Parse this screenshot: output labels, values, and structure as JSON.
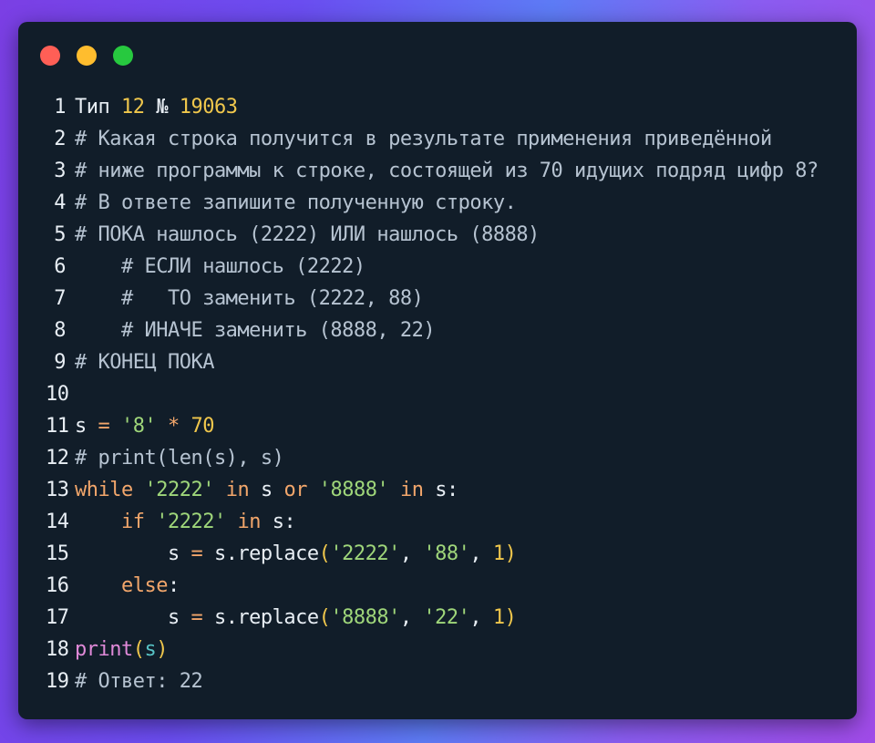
{
  "window": {
    "traffic_lights": [
      "close-dot",
      "minimize-dot",
      "maximize-dot"
    ],
    "colors": {
      "close": "#ff5f56",
      "minimize": "#ffbd2e",
      "maximize": "#27c93f",
      "background": "#111d29"
    }
  },
  "code": {
    "lines": [
      {
        "n": "1",
        "tokens": [
          {
            "t": "Тип ",
            "c": "plain"
          },
          {
            "t": "12",
            "c": "num"
          },
          {
            "t": " № ",
            "c": "plain"
          },
          {
            "t": "19063",
            "c": "num"
          }
        ]
      },
      {
        "n": "2",
        "tokens": [
          {
            "t": "# Какая строка получится в результате применения приведённой",
            "c": "cm"
          }
        ]
      },
      {
        "n": "3",
        "tokens": [
          {
            "t": "# ниже программы к строке, состоящей из 70 идущих подряд цифр 8?",
            "c": "cm"
          }
        ]
      },
      {
        "n": "4",
        "tokens": [
          {
            "t": "# В ответе запишите полученную строку.",
            "c": "cm"
          }
        ]
      },
      {
        "n": "5",
        "tokens": [
          {
            "t": "# ПОКА нашлось (2222) ИЛИ нашлось (8888)",
            "c": "cm"
          }
        ]
      },
      {
        "n": "6",
        "tokens": [
          {
            "t": "    # ЕСЛИ нашлось (2222)",
            "c": "cm"
          }
        ]
      },
      {
        "n": "7",
        "tokens": [
          {
            "t": "    #   ТО заменить (2222, 88)",
            "c": "cm"
          }
        ]
      },
      {
        "n": "8",
        "tokens": [
          {
            "t": "    # ИНАЧЕ заменить (8888, 22)",
            "c": "cm"
          }
        ]
      },
      {
        "n": "9",
        "tokens": [
          {
            "t": "# КОНЕЦ ПОКА",
            "c": "cm"
          }
        ]
      },
      {
        "n": "10",
        "tokens": []
      },
      {
        "n": "11",
        "tokens": [
          {
            "t": "s ",
            "c": "var"
          },
          {
            "t": "=",
            "c": "op"
          },
          {
            "t": " ",
            "c": "plain"
          },
          {
            "t": "'8'",
            "c": "str"
          },
          {
            "t": " ",
            "c": "plain"
          },
          {
            "t": "*",
            "c": "op"
          },
          {
            "t": " ",
            "c": "plain"
          },
          {
            "t": "70",
            "c": "num"
          }
        ]
      },
      {
        "n": "12",
        "tokens": [
          {
            "t": "# print(len(s), s)",
            "c": "cm"
          }
        ]
      },
      {
        "n": "13",
        "tokens": [
          {
            "t": "while",
            "c": "kw"
          },
          {
            "t": " ",
            "c": "plain"
          },
          {
            "t": "'2222'",
            "c": "str"
          },
          {
            "t": " ",
            "c": "plain"
          },
          {
            "t": "in",
            "c": "kw"
          },
          {
            "t": " s ",
            "c": "var"
          },
          {
            "t": "or",
            "c": "kw"
          },
          {
            "t": " ",
            "c": "plain"
          },
          {
            "t": "'8888'",
            "c": "str"
          },
          {
            "t": " ",
            "c": "plain"
          },
          {
            "t": "in",
            "c": "kw"
          },
          {
            "t": " s:",
            "c": "var"
          }
        ]
      },
      {
        "n": "14",
        "tokens": [
          {
            "t": "    ",
            "c": "plain"
          },
          {
            "t": "if",
            "c": "kw"
          },
          {
            "t": " ",
            "c": "plain"
          },
          {
            "t": "'2222'",
            "c": "str"
          },
          {
            "t": " ",
            "c": "plain"
          },
          {
            "t": "in",
            "c": "kw"
          },
          {
            "t": " s:",
            "c": "var"
          }
        ]
      },
      {
        "n": "15",
        "tokens": [
          {
            "t": "        s ",
            "c": "var"
          },
          {
            "t": "=",
            "c": "op"
          },
          {
            "t": " s.replace",
            "c": "meth"
          },
          {
            "t": "(",
            "c": "paren"
          },
          {
            "t": "'2222'",
            "c": "str"
          },
          {
            "t": ", ",
            "c": "plain"
          },
          {
            "t": "'88'",
            "c": "str"
          },
          {
            "t": ", ",
            "c": "plain"
          },
          {
            "t": "1",
            "c": "num"
          },
          {
            "t": ")",
            "c": "paren"
          }
        ]
      },
      {
        "n": "16",
        "tokens": [
          {
            "t": "    ",
            "c": "plain"
          },
          {
            "t": "else",
            "c": "kw"
          },
          {
            "t": ":",
            "c": "plain"
          }
        ]
      },
      {
        "n": "17",
        "tokens": [
          {
            "t": "        s ",
            "c": "var"
          },
          {
            "t": "=",
            "c": "op"
          },
          {
            "t": " s.replace",
            "c": "meth"
          },
          {
            "t": "(",
            "c": "paren"
          },
          {
            "t": "'8888'",
            "c": "str"
          },
          {
            "t": ", ",
            "c": "plain"
          },
          {
            "t": "'22'",
            "c": "str"
          },
          {
            "t": ", ",
            "c": "plain"
          },
          {
            "t": "1",
            "c": "num"
          },
          {
            "t": ")",
            "c": "paren"
          }
        ]
      },
      {
        "n": "18",
        "tokens": [
          {
            "t": "print",
            "c": "fn"
          },
          {
            "t": "(",
            "c": "paren"
          },
          {
            "t": "s",
            "c": "arg"
          },
          {
            "t": ")",
            "c": "paren"
          }
        ]
      },
      {
        "n": "19",
        "tokens": [
          {
            "t": "# Ответ: 22",
            "c": "cm"
          }
        ]
      }
    ]
  }
}
